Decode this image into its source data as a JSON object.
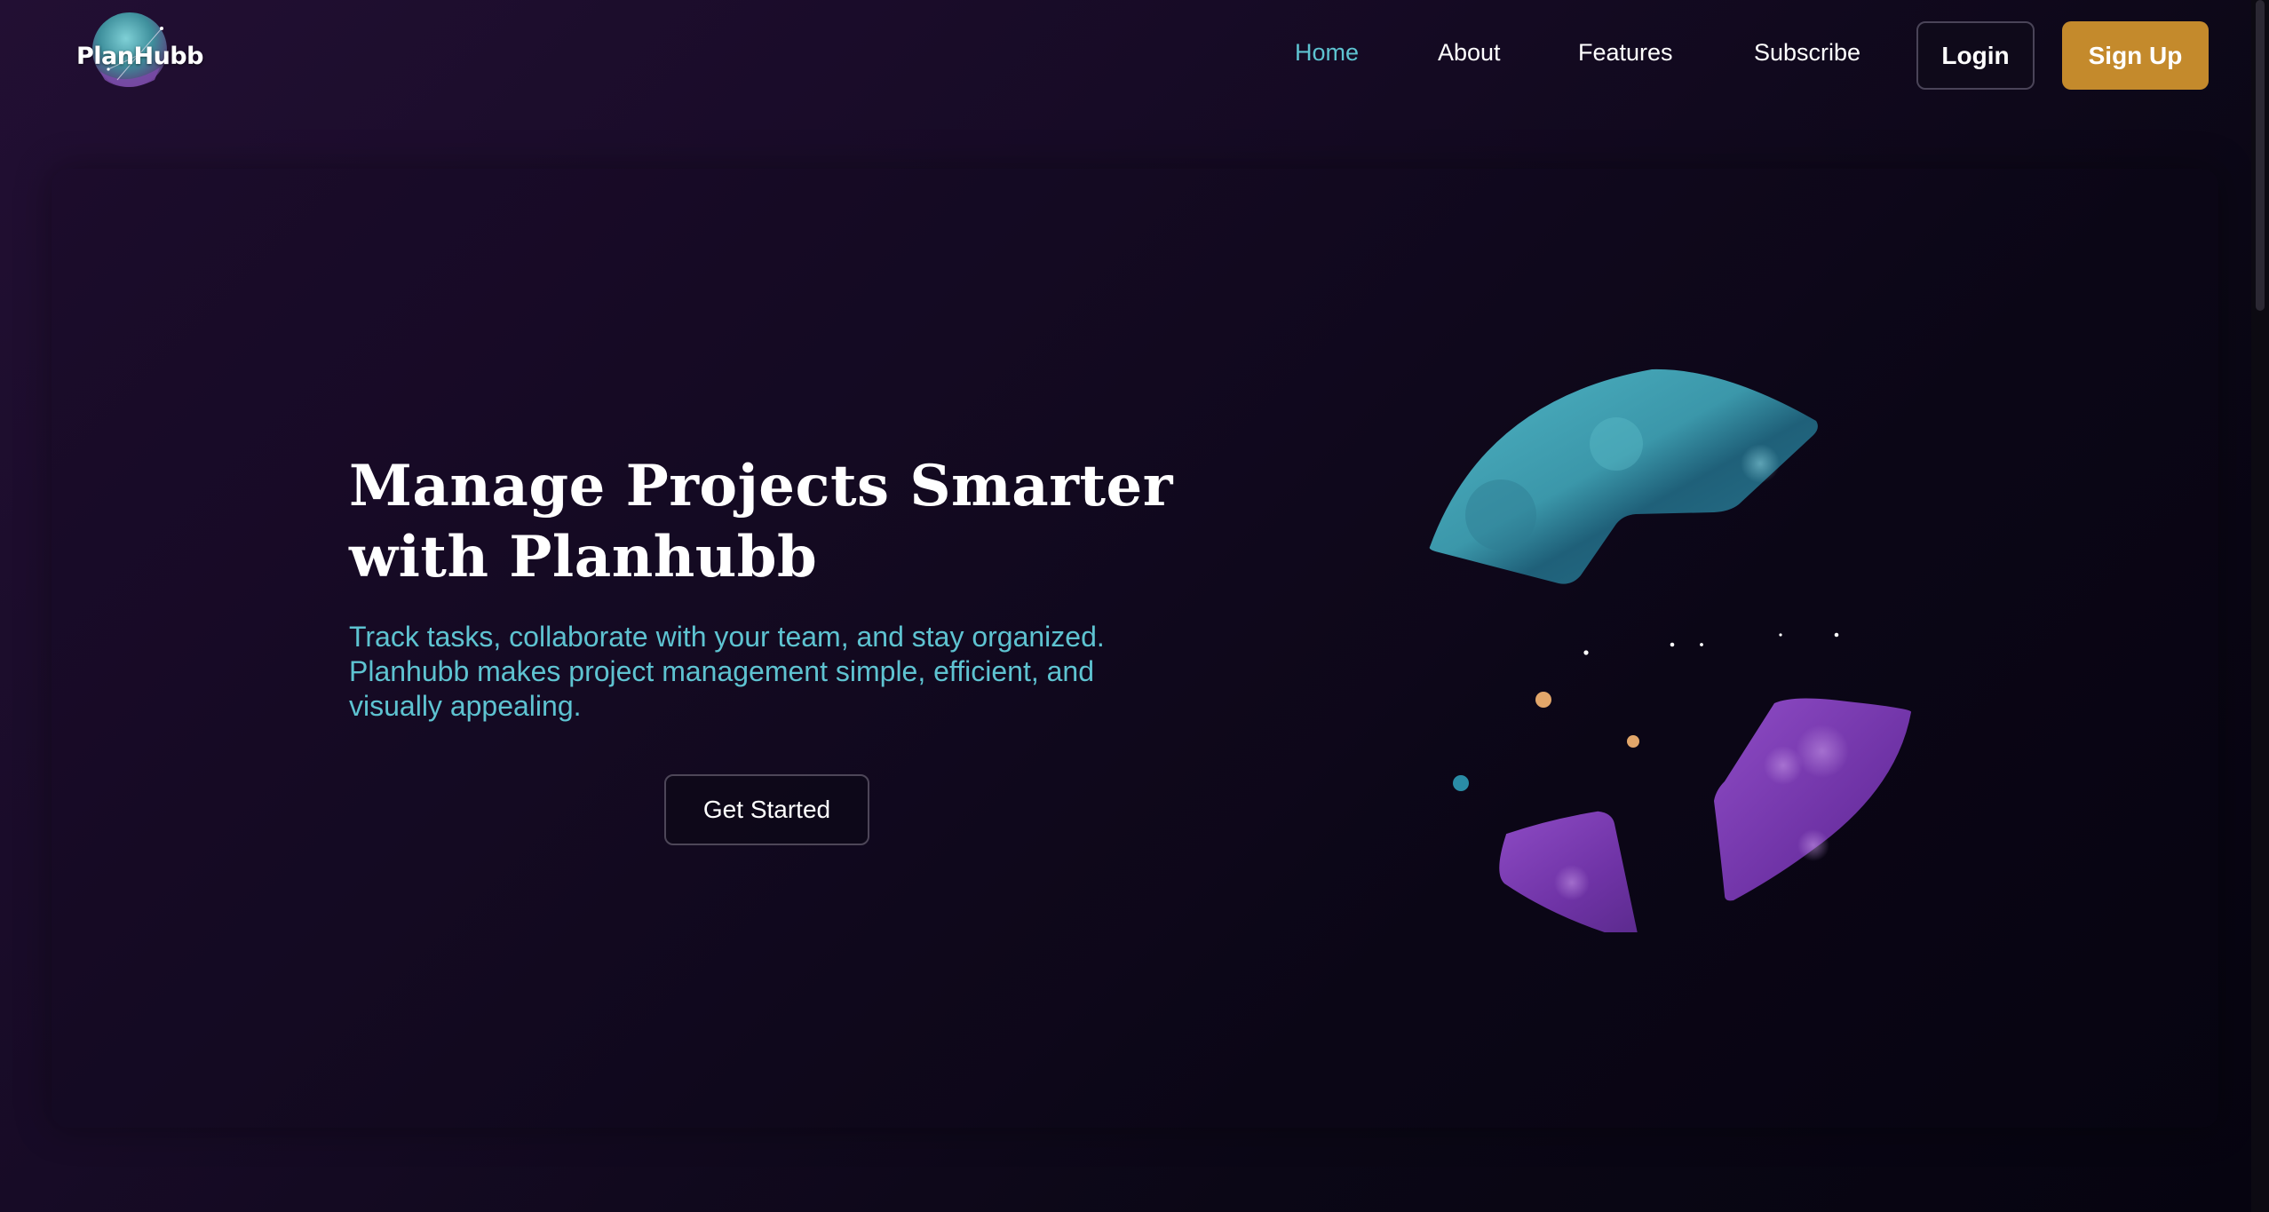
{
  "brand": {
    "logo_text": "PlanHubb"
  },
  "nav": {
    "items": [
      {
        "label": "Home",
        "active": true
      },
      {
        "label": "About",
        "active": false
      },
      {
        "label": "Features",
        "active": false
      },
      {
        "label": "Subscribe",
        "active": false
      }
    ],
    "login_label": "Login",
    "signup_label": "Sign Up"
  },
  "hero": {
    "title_line1": "Manage Projects Smarter",
    "title_line2": "with Planhubb",
    "subtitle": "Track tasks, collaborate with your team, and stay organized. Planhubb makes project management simple, efficient, and visually appealing.",
    "cta_label": "Get Started",
    "illustration_icon": "segmented-globe-icon"
  },
  "colors": {
    "accent_teal": "#5ec3d1",
    "signup_gold": "#c48a2c",
    "segment_purple": "#8a45c0",
    "background_dark": "#0b0716"
  }
}
